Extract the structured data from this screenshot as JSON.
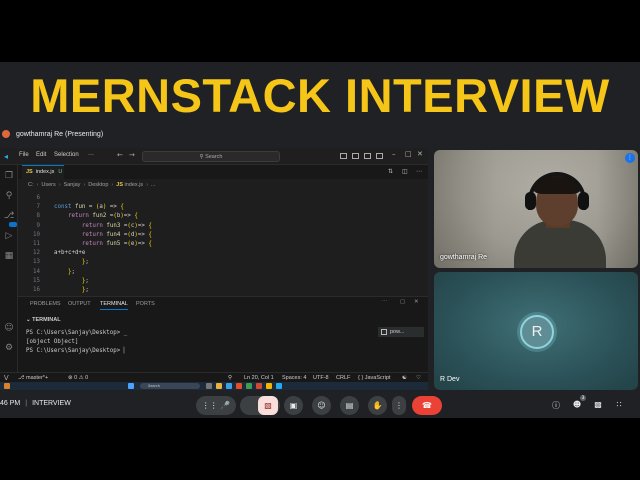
{
  "banner": {
    "title": "MERNSTACK INTERVIEW"
  },
  "meet": {
    "presenter_label": "gowthamraj Re (Presenting)",
    "time": "46 PM",
    "meeting_name": "INTERVIEW",
    "people_count": "3"
  },
  "vscode": {
    "menu": [
      "File",
      "Edit",
      "Selection",
      "···"
    ],
    "search_label": "Search",
    "tab": {
      "lang": "JS",
      "name": "index.js",
      "status": "U"
    },
    "breadcrumb": [
      "C:",
      "Users",
      "Sanjay",
      "Desktop"
    ],
    "breadcrumb_file": {
      "lang": "JS",
      "name": "index.js",
      "more": "..."
    },
    "code_lines": [
      {
        "n": "6",
        "text": ""
      },
      {
        "n": "7",
        "text": "const fun = (a) => {"
      },
      {
        "n": "8",
        "text": "    return fun2 =(b)=> {"
      },
      {
        "n": "9",
        "text": "        return fun3 =(c)=> {"
      },
      {
        "n": "10",
        "text": "        return fun4 =(d)=> {"
      },
      {
        "n": "11",
        "text": "        return fun5 =(e)=> {"
      },
      {
        "n": "12",
        "text": "a+b+c+d+e"
      },
      {
        "n": "13",
        "text": "        };"
      },
      {
        "n": "14",
        "text": "    };"
      },
      {
        "n": "15",
        "text": "        };"
      },
      {
        "n": "16",
        "text": "        };"
      }
    ],
    "panel_tabs": [
      "PROBLEMS",
      "OUTPUT",
      "TERMINAL",
      "PORTS"
    ],
    "terminal_header": "TERMINAL",
    "terminal_lines": [
      "PS C:\\Users\\Sanjay\\Desktop> _",
      "[object Object]",
      "PS C:\\Users\\Sanjay\\Desktop> ▏"
    ],
    "terminal_instance": "pow...",
    "status": {
      "branch": "master*+",
      "errors": "⊗ 0 ⚠ 0",
      "position": "Ln 20, Col 1",
      "spaces": "Spaces: 4",
      "encoding": "UTF-8",
      "eol": "CRLF",
      "language": "{ } JavaScript"
    },
    "taskbar_search": "Search"
  },
  "participants": [
    {
      "name": "gowthamraj Re"
    },
    {
      "name": "R Dev",
      "initial": "R"
    }
  ],
  "icons": {
    "vscode": "vscode-logo-icon",
    "explorer": "files-icon",
    "search": "search-icon",
    "source_control": "source-control-icon",
    "run": "run-debug-icon",
    "extensions": "extensions-icon",
    "account": "account-icon",
    "settings": "gear-icon"
  },
  "colors": {
    "banner_text": "#f5c518",
    "leave_button": "#ea4335",
    "vscode_accent": "#0078d4"
  }
}
